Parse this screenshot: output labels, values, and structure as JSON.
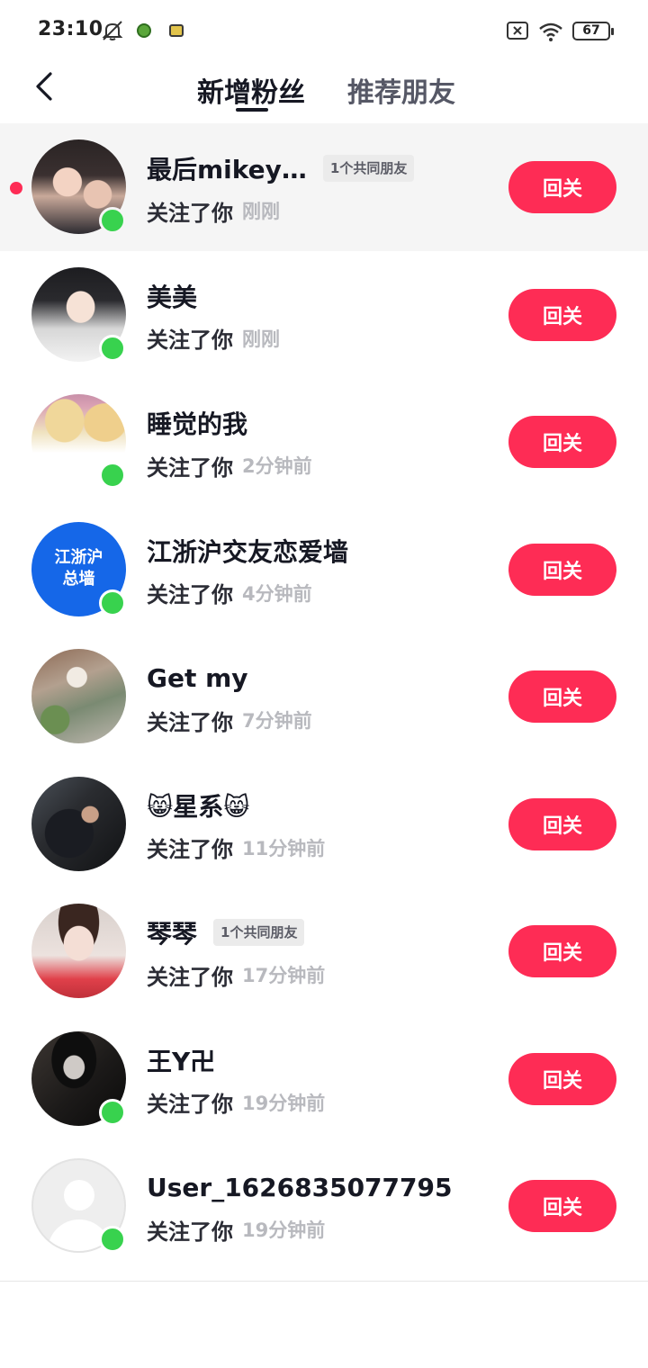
{
  "status_bar": {
    "time": "23:10",
    "battery": "67"
  },
  "header": {
    "tabs": [
      {
        "label": "新增粉丝",
        "active": true
      },
      {
        "label": "推荐朋友",
        "active": false
      }
    ]
  },
  "followers": [
    {
      "name": "最后mikey…",
      "mutual": "1个共同朋友",
      "action": "关注了你",
      "time": "刚刚",
      "button": "回关",
      "unread": true,
      "online": true
    },
    {
      "name": "美美",
      "mutual": "",
      "action": "关注了你",
      "time": "刚刚",
      "button": "回关",
      "unread": false,
      "online": true
    },
    {
      "name": "睡觉的我",
      "mutual": "",
      "action": "关注了你",
      "time": "2分钟前",
      "button": "回关",
      "unread": false,
      "online": true
    },
    {
      "name": "江浙沪交友恋爱墙",
      "mutual": "",
      "action": "关注了你",
      "time": "4分钟前",
      "button": "回关",
      "unread": false,
      "online": true,
      "avatar_text": [
        "江浙沪",
        "总墙"
      ]
    },
    {
      "name": "Get my",
      "mutual": "",
      "action": "关注了你",
      "time": "7分钟前",
      "button": "回关",
      "unread": false,
      "online": false
    },
    {
      "name": "😸星系😸",
      "mutual": "",
      "action": "关注了你",
      "time": "11分钟前",
      "button": "回关",
      "unread": false,
      "online": false
    },
    {
      "name": "琴琴",
      "mutual": "1个共同朋友",
      "action": "关注了你",
      "time": "17分钟前",
      "button": "回关",
      "unread": false,
      "online": false
    },
    {
      "name": "王Y卍",
      "mutual": "",
      "action": "关注了你",
      "time": "19分钟前",
      "button": "回关",
      "unread": false,
      "online": true
    },
    {
      "name": "User_1626835077795",
      "mutual": "",
      "action": "关注了你",
      "time": "19分钟前",
      "button": "回关",
      "unread": false,
      "online": true
    }
  ],
  "colors": {
    "accent": "#fe2c55",
    "online": "#38d24e",
    "highlight_row": "#f5f5f5"
  }
}
